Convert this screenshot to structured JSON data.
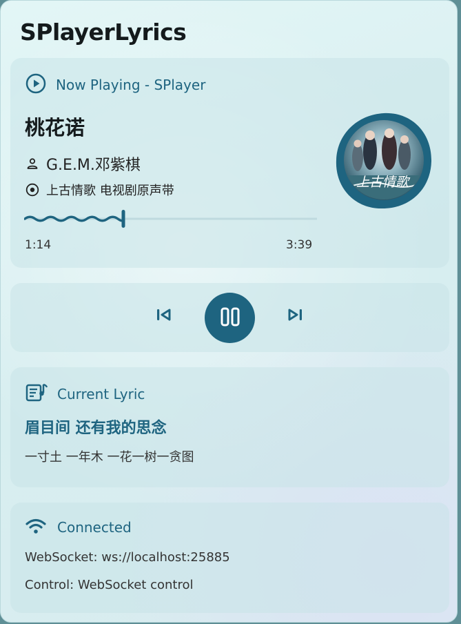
{
  "app": {
    "title": "SPlayerLyrics"
  },
  "now_playing": {
    "header": "Now Playing - SPlayer",
    "song_title": "桃花诺",
    "artist": "G.E.M.邓紫棋",
    "album": "上古情歌 电视剧原声带",
    "current_time": "1:14",
    "total_time": "3:39",
    "progress": 0.337,
    "cover_text": "上古情歌"
  },
  "controls": {
    "prev_icon": "skip-previous-icon",
    "play_icon": "pause-icon",
    "next_icon": "skip-next-icon"
  },
  "lyric": {
    "header": "Current Lyric",
    "current_line": "眉目间 还有我的思念",
    "next_line": "一寸土 一年木 一花一树一贪图"
  },
  "connection": {
    "status": "Connected",
    "websocket": "WebSocket: ws://localhost:25885",
    "control": "Control: WebSocket control"
  },
  "colors": {
    "accent": "#1e6480",
    "text": "#141a1c",
    "card_bg": "#c8e4e8"
  }
}
